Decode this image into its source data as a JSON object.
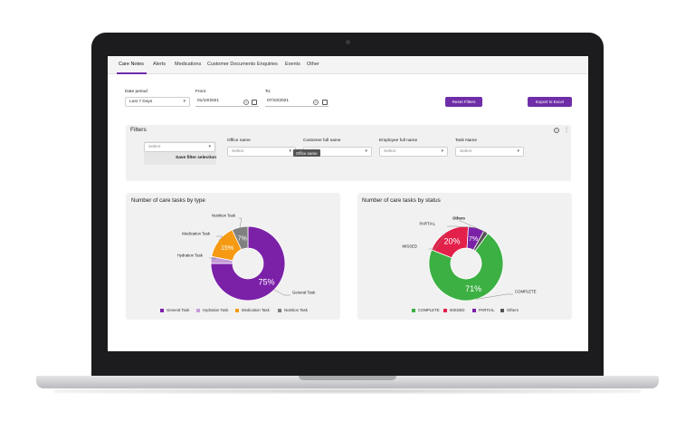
{
  "tabs": [
    {
      "label": "Care Notes",
      "active": true
    },
    {
      "label": "Alerts"
    },
    {
      "label": "Medications"
    },
    {
      "label": "Customer Documents"
    },
    {
      "label": "Enquiries"
    },
    {
      "label": "Events"
    },
    {
      "label": "Other"
    }
  ],
  "filters_bar": {
    "date_period_label": "Date period",
    "date_period_value": "Last 7 Days",
    "from_label": "From:",
    "from_value": "01/10/2021",
    "to_label": "To:",
    "to_value": "07/10/2021",
    "reset_button": "Reset Filters",
    "export_button": "Export to Excel"
  },
  "filters_panel": {
    "title": "Filters",
    "saved_select_placeholder": "Select",
    "save_selection_label": "Save filter selection",
    "fields": [
      {
        "label": "Office name",
        "placeholder": "Select"
      },
      {
        "label": "Customer full name",
        "placeholder": "Select"
      },
      {
        "label": "Employee full name",
        "placeholder": "Select"
      },
      {
        "label": "Task Name",
        "placeholder": "Select"
      }
    ],
    "tooltip": "Office name"
  },
  "charts_text": {
    "type_slice_pct": [
      "75%",
      "15%",
      "7%"
    ],
    "status_slice_pct": [
      "71%",
      "20%",
      "7%"
    ]
  },
  "colors": {
    "accent": "#6f2da8",
    "general": "#7b21a8",
    "hydration": "#c59bd9",
    "medication": "#f59a12",
    "nutrition": "#808080",
    "complete": "#3cb043",
    "missed": "#e3204a",
    "partial": "#7b21a8",
    "others": "#555555"
  },
  "chart_data": [
    {
      "type": "pie",
      "title": "Number of care tasks by type",
      "categories": [
        "General Task",
        "Hydration Task",
        "Medication Task",
        "Nutrition Task"
      ],
      "values": [
        75,
        3,
        15,
        7
      ],
      "colors": [
        "#7b21a8",
        "#c59bd9",
        "#f59a12",
        "#808080"
      ],
      "data_labels": [
        "75%",
        "",
        "15%",
        "7%"
      ],
      "legend_position": "bottom"
    },
    {
      "type": "pie",
      "title": "Number of care tasks by status",
      "categories": [
        "COMPLETE",
        "MISSED",
        "PARTIAL",
        "Others"
      ],
      "values": [
        71,
        20,
        7,
        2
      ],
      "colors": [
        "#3cb043",
        "#e3204a",
        "#7b21a8",
        "#555555"
      ],
      "data_labels": [
        "71%",
        "20%",
        "7%",
        ""
      ],
      "legend_position": "bottom"
    }
  ]
}
